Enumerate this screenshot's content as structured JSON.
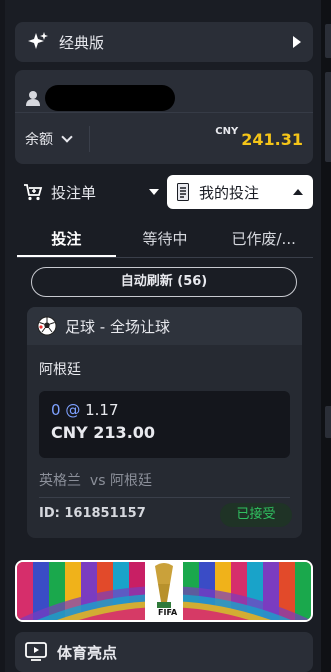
{
  "classic": {
    "label": "经典版"
  },
  "account": {
    "balance_label": "余额",
    "currency": "CNY",
    "amount": "241.31"
  },
  "betslip_tab": {
    "label": "投注单"
  },
  "mybets_tab": {
    "label": "我的投注"
  },
  "subtabs": [
    {
      "label": "投注",
      "active": true
    },
    {
      "label": "等待中",
      "active": false
    },
    {
      "label": "已作废/...",
      "active": false
    }
  ],
  "refresh": {
    "label": "自动刷新 (56)"
  },
  "bet": {
    "sport_market": "足球 - 全场让球",
    "selection": "阿根廷",
    "handicap": "0",
    "at": "@",
    "odds": "1.17",
    "stake": "CNY 213.00",
    "home": "英格兰",
    "vs": "vs",
    "away": "阿根廷",
    "id": "ID: 161851157",
    "status": "已接受"
  },
  "banner": {
    "logo_text": "FIFA"
  },
  "highlights": {
    "label": "体育亮点"
  }
}
